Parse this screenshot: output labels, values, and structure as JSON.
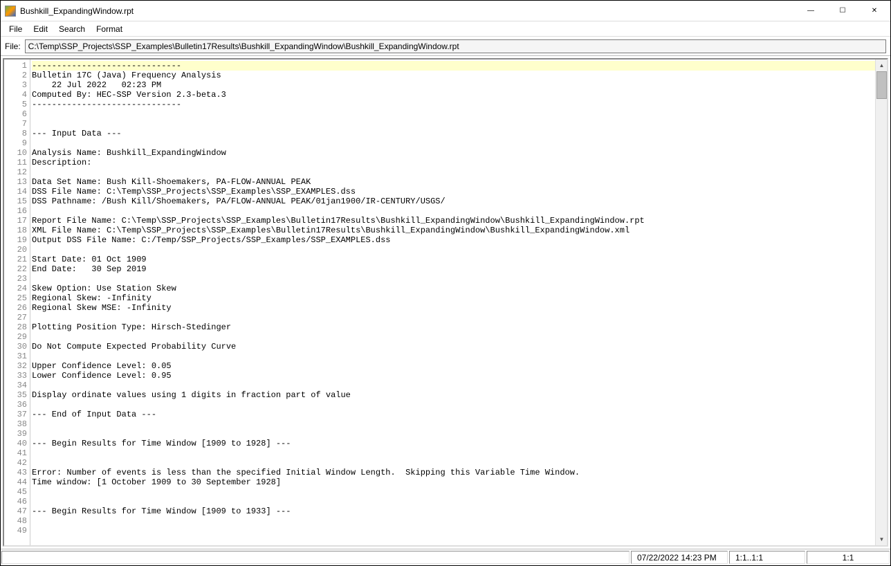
{
  "window": {
    "title": "Bushkill_ExpandingWindow.rpt"
  },
  "menu": {
    "file": "File",
    "edit": "Edit",
    "search": "Search",
    "format": "Format"
  },
  "filebar": {
    "label": "File:",
    "path": "C:\\Temp\\SSP_Projects\\SSP_Examples\\Bulletin17Results\\Bushkill_ExpandingWindow\\Bushkill_ExpandingWindow.rpt"
  },
  "editor": {
    "first_line_number": 1,
    "last_line_number": 49,
    "highlighted_line": 1,
    "lines": [
      "------------------------------",
      "Bulletin 17C (Java) Frequency Analysis",
      "    22 Jul 2022   02:23 PM",
      "Computed By: HEC-SSP Version 2.3-beta.3",
      "------------------------------",
      "",
      "",
      "--- Input Data ---",
      "",
      "Analysis Name: Bushkill_ExpandingWindow",
      "Description: ",
      "",
      "Data Set Name: Bush Kill-Shoemakers, PA-FLOW-ANNUAL PEAK",
      "DSS File Name: C:\\Temp\\SSP_Projects\\SSP_Examples\\SSP_EXAMPLES.dss",
      "DSS Pathname: /Bush Kill/Shoemakers, PA/FLOW-ANNUAL PEAK/01jan1900/IR-CENTURY/USGS/",
      "",
      "Report File Name: C:\\Temp\\SSP_Projects\\SSP_Examples\\Bulletin17Results\\Bushkill_ExpandingWindow\\Bushkill_ExpandingWindow.rpt",
      "XML File Name: C:\\Temp\\SSP_Projects\\SSP_Examples\\Bulletin17Results\\Bushkill_ExpandingWindow\\Bushkill_ExpandingWindow.xml",
      "Output DSS File Name: C:/Temp/SSP_Projects/SSP_Examples/SSP_EXAMPLES.dss",
      "",
      "Start Date: 01 Oct 1909",
      "End Date:   30 Sep 2019",
      "",
      "Skew Option: Use Station Skew",
      "Regional Skew: -Infinity",
      "Regional Skew MSE: -Infinity",
      "",
      "Plotting Position Type: Hirsch-Stedinger",
      "",
      "Do Not Compute Expected Probability Curve",
      "",
      "Upper Confidence Level: 0.05",
      "Lower Confidence Level: 0.95",
      "",
      "Display ordinate values using 1 digits in fraction part of value",
      "",
      "--- End of Input Data ---",
      "",
      "",
      "--- Begin Results for Time Window [1909 to 1928] ---",
      "",
      "",
      "Error: Number of events is less than the specified Initial Window Length.  Skipping this Variable Time Window.",
      "Time window: [1 October 1909 to 30 September 1928]",
      "",
      "",
      "--- Begin Results for Time Window [1909 to 1933] ---",
      "",
      ""
    ]
  },
  "status": {
    "datetime": "07/22/2022 14:23 PM",
    "range": "1:1..1:1",
    "pos": "1:1"
  }
}
